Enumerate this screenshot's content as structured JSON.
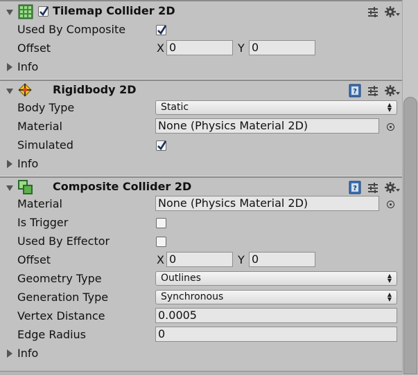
{
  "tilemap_collider": {
    "title": "Tilemap Collider 2D",
    "used_by_composite_label": "Used By Composite",
    "used_by_composite": true,
    "offset_label": "Offset",
    "offset_x_axis": "X",
    "offset_x": "0",
    "offset_y_axis": "Y",
    "offset_y": "0",
    "info_label": "Info"
  },
  "rigidbody": {
    "title": "Rigidbody 2D",
    "body_type_label": "Body Type",
    "body_type": "Static",
    "material_label": "Material",
    "material": "None (Physics Material 2D)",
    "simulated_label": "Simulated",
    "simulated": true,
    "info_label": "Info"
  },
  "composite_collider": {
    "title": "Composite Collider 2D",
    "material_label": "Material",
    "material": "None (Physics Material 2D)",
    "is_trigger_label": "Is Trigger",
    "is_trigger": false,
    "used_by_effector_label": "Used By Effector",
    "used_by_effector": false,
    "offset_label": "Offset",
    "offset_x_axis": "X",
    "offset_x": "0",
    "offset_y_axis": "Y",
    "offset_y": "0",
    "geometry_type_label": "Geometry Type",
    "geometry_type": "Outlines",
    "generation_type_label": "Generation Type",
    "generation_type": "Synchronous",
    "vertex_distance_label": "Vertex Distance",
    "vertex_distance": "0.0005",
    "edge_radius_label": "Edge Radius",
    "edge_radius": "0",
    "info_label": "Info"
  },
  "icons": {
    "tilemap": "tilemap-collider-icon",
    "rigidbody": "rigidbody-icon",
    "composite": "composite-collider-icon",
    "help": "help-book-icon",
    "presets": "presets-icon",
    "settings": "gear-icon",
    "object_picker": "object-picker-icon"
  },
  "colors": {
    "background": "#c2c2c2",
    "checkmark": "#1a2f5c",
    "field": "#e6e6e6"
  }
}
